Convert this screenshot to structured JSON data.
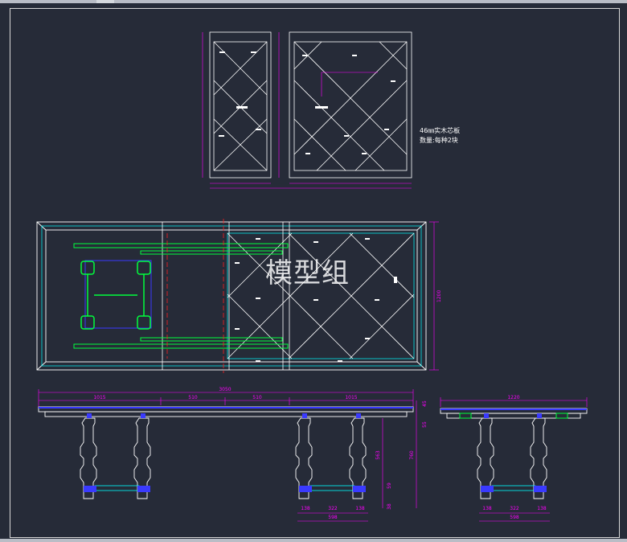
{
  "notes": {
    "line1": "46㎜实木芯板",
    "line2": "数量:每种2块"
  },
  "watermark": "模型组",
  "dimensions": {
    "overall_length": "3050",
    "segments": [
      "1015",
      "510",
      "510",
      "1015"
    ],
    "width_plan": "1200",
    "width_side": "1220",
    "height_total": "760",
    "height_leg": "563",
    "height_top_a": "45",
    "height_top_b": "55",
    "height_stretcher": "59",
    "height_foot": "38",
    "leg_span_a": "138",
    "leg_span_b": "322",
    "leg_span_c": "138",
    "leg_base": "598"
  },
  "colors": {
    "background": "#262b38",
    "lines": "#ffffff",
    "dimension": "#ff00ff",
    "hatch": "#00ffff",
    "green": "#00ff3c",
    "blue": "#3a3aff",
    "red": "#ff2020"
  }
}
